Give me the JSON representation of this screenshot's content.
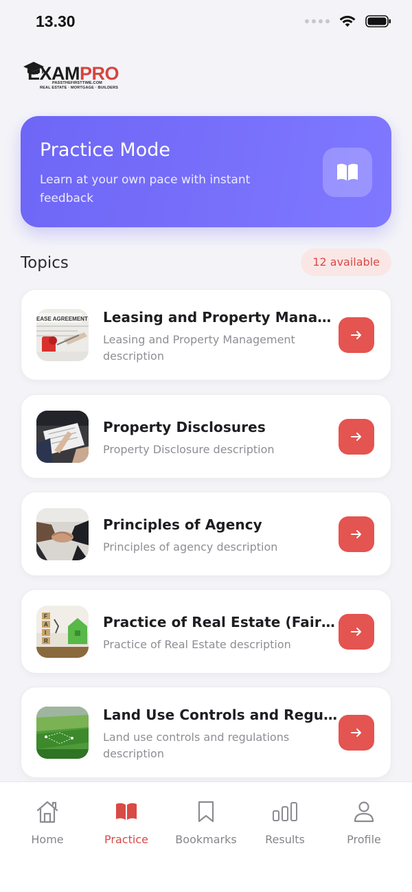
{
  "status_bar": {
    "time": "13.30"
  },
  "logo": {
    "exam": "EXAM",
    "pro": "PRO",
    "tagline": "PASSTHEFIRSTTIME.COM",
    "subline": "REAL ESTATE · MORTGAGE · BUILDERS"
  },
  "hero": {
    "title": "Practice Mode",
    "subtitle": "Learn at your own pace with instant feedback",
    "icon": "open-book-icon"
  },
  "topics": {
    "title": "Topics",
    "count_badge": "12 available",
    "items": [
      {
        "title": "Leasing and Property Manage…",
        "description": "Leasing and Property Management description",
        "thumb": "lease-agreement"
      },
      {
        "title": "Property Disclosures",
        "description": "Property Disclosure description",
        "thumb": "signing-documents"
      },
      {
        "title": "Principles of Agency",
        "description": "Principles of agency description",
        "thumb": "handshake"
      },
      {
        "title": "Practice of Real Estate (Fair H…",
        "description": "Practice of Real Estate description",
        "thumb": "fair-housing"
      },
      {
        "title": "Land Use Controls and Regula…",
        "description": "Land use controls and regulations description",
        "thumb": "aerial-land"
      }
    ]
  },
  "nav": {
    "items": [
      {
        "label": "Home",
        "icon": "home-icon"
      },
      {
        "label": "Practice",
        "icon": "book-icon",
        "active": true
      },
      {
        "label": "Bookmarks",
        "icon": "bookmark-icon"
      },
      {
        "label": "Results",
        "icon": "bar-chart-icon"
      },
      {
        "label": "Profile",
        "icon": "user-icon"
      }
    ]
  },
  "colors": {
    "accent": "#e45450",
    "hero_start": "#6e66f6",
    "hero_end": "#7f78ff",
    "background": "#f4f4f8"
  }
}
